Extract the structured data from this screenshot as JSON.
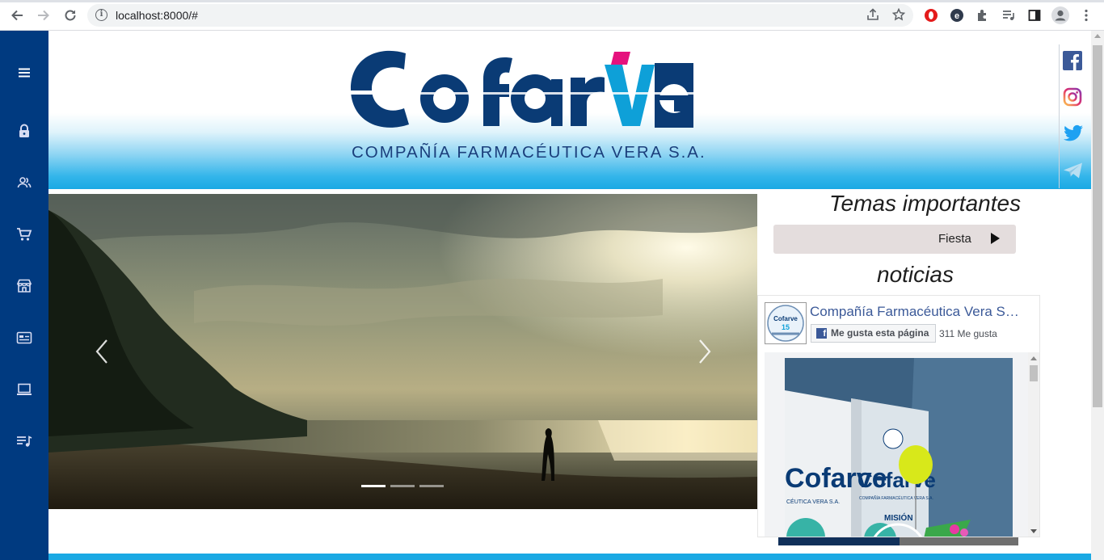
{
  "browser": {
    "url": "localhost:8000/#",
    "back_icon": "arrow-left-icon",
    "forward_icon": "arrow-right-icon",
    "reload_icon": "reload-icon",
    "info_icon": "info-icon",
    "share_icon": "share-icon",
    "bookmark_icon": "star-icon",
    "extensions": [
      "opera-extension-icon",
      "e-extension-icon",
      "puzzle-extension-icon",
      "media-list-icon",
      "side-panel-icon",
      "profile-icon",
      "kebab-menu-icon"
    ]
  },
  "sidebar": {
    "background": "#003a80",
    "items": [
      {
        "icon": "menu-icon"
      },
      {
        "icon": "lock-icon"
      },
      {
        "icon": "users-icon"
      },
      {
        "icon": "cart-icon"
      },
      {
        "icon": "store-icon"
      },
      {
        "icon": "id-card-icon"
      },
      {
        "icon": "laptop-icon"
      },
      {
        "icon": "playlist-icon"
      }
    ]
  },
  "header": {
    "brand_mark": "Cofarve",
    "brand_subtitle": "COMPAÑÍA FARMACÉUTICA VERA S.A.",
    "brand_colors": {
      "navy": "#0a3b75",
      "cyan": "#0ea0d8",
      "magenta": "#e5127d"
    },
    "social": [
      {
        "icon": "facebook-icon",
        "color": "#3b5998"
      },
      {
        "icon": "instagram-icon",
        "color": "#e1306c"
      },
      {
        "icon": "twitter-icon",
        "color": "#1da1f2"
      },
      {
        "icon": "telegram-icon",
        "color": "#2aa3dc"
      }
    ]
  },
  "carousel": {
    "slide_count": 3,
    "active_index": 0,
    "prev_icon": "chevron-left-icon",
    "next_icon": "chevron-right-icon"
  },
  "temas": {
    "title": "Temas importantes",
    "items": [
      {
        "label": "Fiesta",
        "icon": "play-icon"
      }
    ]
  },
  "noticias": {
    "title": "noticias",
    "fb_page_name": "Compañía Farmacéutica Vera S.A.",
    "like_button": "Me gusta esta página",
    "like_count": "311 Me gusta",
    "post_banner_left": "Cofarve",
    "post_banner_left_sub": "CÉUTICA VERA S.A.",
    "post_banner_right": "Cofarve",
    "post_banner_right_sub": "COMPAÑÍA FARMACÉUTICA VERA S.A.",
    "post_banner_small": "MISIÓN"
  }
}
